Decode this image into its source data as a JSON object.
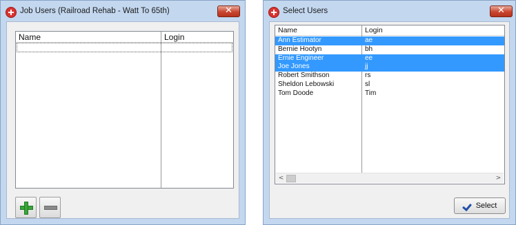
{
  "left_window": {
    "title": "Job Users (Railroad Rehab - Watt To 65th)",
    "close_glyph": "✕",
    "columns": [
      "Name",
      "Login"
    ],
    "rows": [],
    "buttons": {
      "add_icon": "plus-icon",
      "remove_icon": "minus-icon"
    }
  },
  "right_window": {
    "title": "Select Users",
    "close_glyph": "✕",
    "columns": [
      "Name",
      "Login"
    ],
    "rows": [
      {
        "name": "Ann Estimator",
        "login": "ae",
        "selected": true
      },
      {
        "name": "Bernie Hootyn",
        "login": "bh",
        "selected": false
      },
      {
        "name": "Ernie Engineer",
        "login": "ee",
        "selected": true
      },
      {
        "name": "Joe Jones",
        "login": "jj",
        "selected": true
      },
      {
        "name": "Robert Smithson",
        "login": "rs",
        "selected": false
      },
      {
        "name": "Sheldon Lebowski",
        "login": "sl",
        "selected": false
      },
      {
        "name": "Tom Doode",
        "login": "Tim",
        "selected": false
      }
    ],
    "select_label": "Select",
    "scroll_left": "<",
    "scroll_right": ">"
  },
  "colors": {
    "selection": "#3399ff",
    "window_frame": "#c3d7ef",
    "close_button": "#c9462f",
    "add_green": "#3aa53a"
  }
}
